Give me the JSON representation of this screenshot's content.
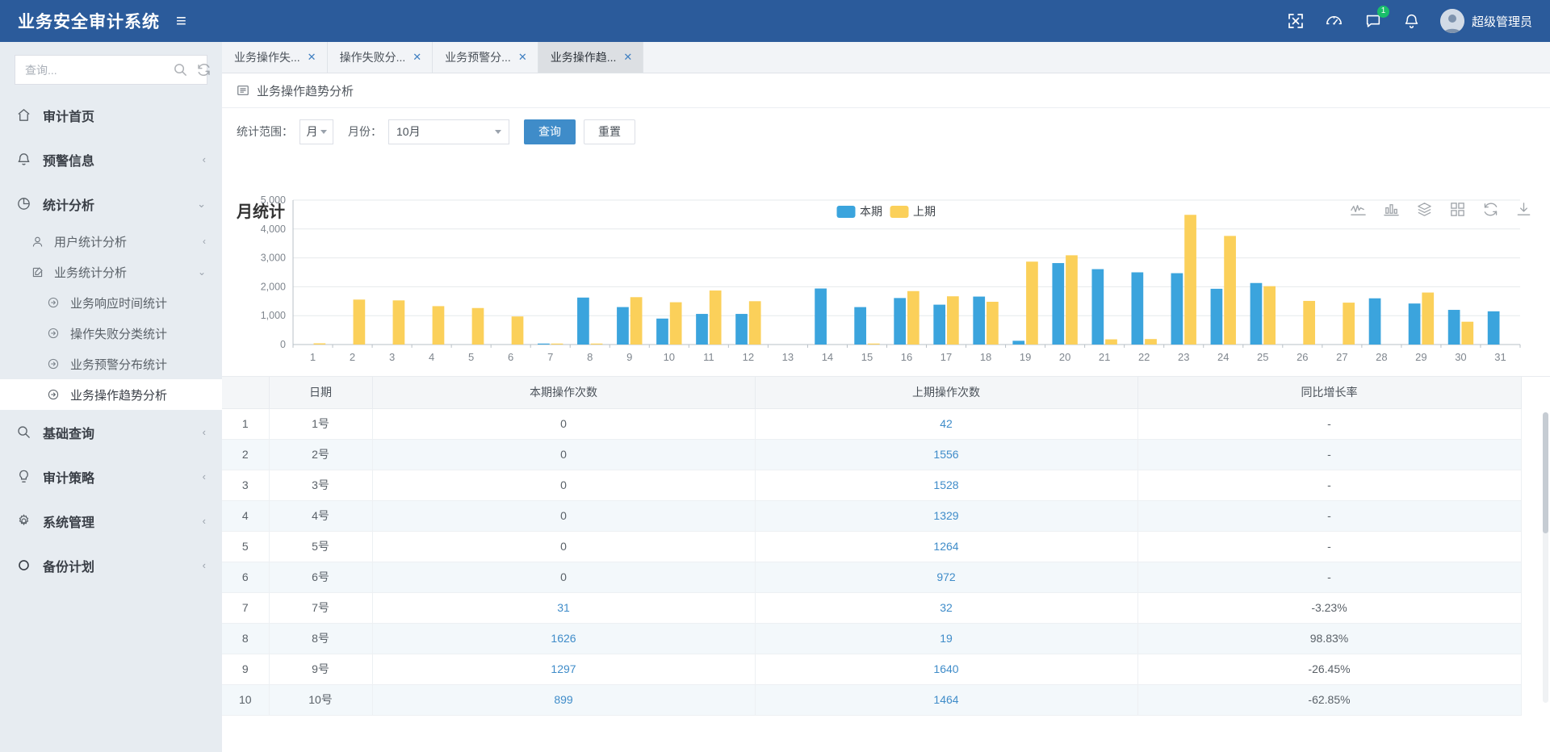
{
  "header": {
    "brand": "业务安全审计系统",
    "menu_toggle": "≡",
    "user_name": "超级管理员",
    "notification_badge": "1",
    "icons": [
      "fullscreen-icon",
      "dashboard-icon",
      "message-icon",
      "bell-icon"
    ]
  },
  "sidebar": {
    "search_placeholder": "查询...",
    "items": [
      {
        "label": "审计首页",
        "icon": "home-icon",
        "arrow": ""
      },
      {
        "label": "预警信息",
        "icon": "bell-icon",
        "arrow": "‹"
      },
      {
        "label": "统计分析",
        "icon": "pie-chart-icon",
        "arrow": "⌄"
      },
      {
        "label": "基础查询",
        "icon": "search-icon",
        "arrow": "‹"
      },
      {
        "label": "审计策略",
        "icon": "bulb-icon",
        "arrow": "‹"
      },
      {
        "label": "系统管理",
        "icon": "gear-icon",
        "arrow": "‹"
      },
      {
        "label": "备份计划",
        "icon": "circle-icon",
        "arrow": "‹"
      }
    ],
    "sub_items": [
      {
        "label": "用户统计分析",
        "icon": "user-icon",
        "arrow": "‹"
      },
      {
        "label": "业务统计分析",
        "icon": "edit-icon",
        "arrow": "⌄"
      }
    ],
    "leaf_items": [
      {
        "label": "业务响应时间统计",
        "icon": "arrow-right-circle-icon",
        "active": false
      },
      {
        "label": "操作失败分类统计",
        "icon": "arrow-right-circle-icon",
        "active": false
      },
      {
        "label": "业务预警分布统计",
        "icon": "arrow-right-circle-icon",
        "active": false
      },
      {
        "label": "业务操作趋势分析",
        "icon": "arrow-right-circle-icon",
        "active": true
      }
    ]
  },
  "tabs": [
    {
      "label": "业务操作失...",
      "active": false,
      "close": "✕"
    },
    {
      "label": "操作失败分...",
      "active": false,
      "close": "✕"
    },
    {
      "label": "业务预警分...",
      "active": false,
      "close": "✕"
    },
    {
      "label": "业务操作趋...",
      "active": true,
      "close": "✕"
    }
  ],
  "panel": {
    "title": "业务操作趋势分析",
    "icon": "list-panel-icon"
  },
  "filters": {
    "scope_label": "统计范围：",
    "scope_value": "月",
    "month_label": "月份：",
    "month_value": "10月",
    "query_button": "查询",
    "reset_button": "重置"
  },
  "chart_toolbar": {
    "icons": [
      "line-chart-icon",
      "bar-chart-icon",
      "stack-layers-icon",
      "grid-icon",
      "refresh-icon",
      "download-icon"
    ]
  },
  "chart_data": {
    "type": "bar",
    "title": "月统计",
    "xlabel": "",
    "ylabel": "",
    "ylim": [
      0,
      5000
    ],
    "yticks": [
      0,
      1000,
      2000,
      3000,
      4000,
      5000
    ],
    "ytick_labels": [
      "0",
      "1,000",
      "2,000",
      "3,000",
      "4,000",
      "5,000"
    ],
    "grid": true,
    "legend_position": "top-center",
    "colors": {
      "current": "#3ba4dd",
      "previous": "#fbd05a"
    },
    "categories": [
      "1",
      "2",
      "3",
      "4",
      "5",
      "6",
      "7",
      "8",
      "9",
      "10",
      "11",
      "12",
      "13",
      "14",
      "15",
      "16",
      "17",
      "18",
      "19",
      "20",
      "21",
      "22",
      "23",
      "24",
      "25",
      "26",
      "27",
      "28",
      "29",
      "30",
      "31"
    ],
    "series": [
      {
        "name": "本期",
        "color": "#3ba4dd",
        "values": [
          0,
          0,
          0,
          0,
          0,
          0,
          31,
          1626,
          1297,
          899,
          1060,
          1060,
          0,
          1940,
          1296,
          1610,
          1380,
          1660,
          130,
          2820,
          2610,
          2500,
          2470,
          1930,
          2130,
          0,
          0,
          1600,
          1420,
          1200,
          1150
        ]
      },
      {
        "name": "上期",
        "color": "#fbd05a",
        "values": [
          42,
          1556,
          1528,
          1329,
          1264,
          972,
          32,
          19,
          1640,
          1464,
          1870,
          1500,
          0,
          0,
          20,
          1850,
          1670,
          1480,
          2870,
          3090,
          180,
          190,
          4490,
          3760,
          2020,
          1510,
          1450,
          0,
          1800,
          790,
          0
        ]
      }
    ]
  },
  "table": {
    "headers": [
      "",
      "日期",
      "本期操作次数",
      "上期操作次数",
      "同比增长率"
    ],
    "rows": [
      {
        "idx": "1",
        "date": "1号",
        "current": "0",
        "previous": "42",
        "rate": "-"
      },
      {
        "idx": "2",
        "date": "2号",
        "current": "0",
        "previous": "1556",
        "rate": "-"
      },
      {
        "idx": "3",
        "date": "3号",
        "current": "0",
        "previous": "1528",
        "rate": "-"
      },
      {
        "idx": "4",
        "date": "4号",
        "current": "0",
        "previous": "1329",
        "rate": "-"
      },
      {
        "idx": "5",
        "date": "5号",
        "current": "0",
        "previous": "1264",
        "rate": "-"
      },
      {
        "idx": "6",
        "date": "6号",
        "current": "0",
        "previous": "972",
        "rate": "-"
      },
      {
        "idx": "7",
        "date": "7号",
        "current": "31",
        "previous": "32",
        "rate": "-3.23%"
      },
      {
        "idx": "8",
        "date": "8号",
        "current": "1626",
        "previous": "19",
        "rate": "98.83%"
      },
      {
        "idx": "9",
        "date": "9号",
        "current": "1297",
        "previous": "1640",
        "rate": "-26.45%"
      },
      {
        "idx": "10",
        "date": "10号",
        "current": "899",
        "previous": "1464",
        "rate": "-62.85%"
      }
    ]
  }
}
